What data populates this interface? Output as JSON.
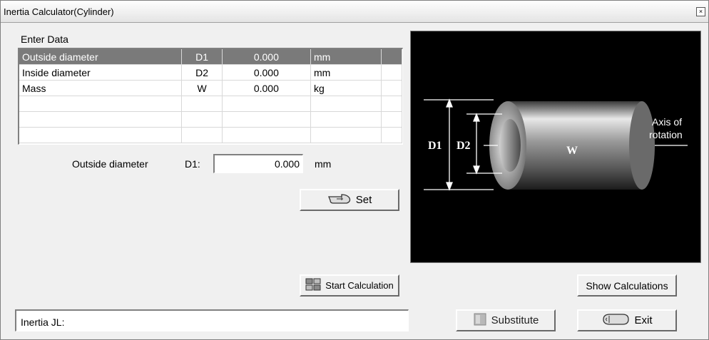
{
  "window": {
    "title": "Inertia Calculator(Cylinder)",
    "close_glyph": "×"
  },
  "enter_data_label": "Enter Data",
  "table": {
    "rows": [
      {
        "name": "Outside diameter",
        "symbol": "D1",
        "value": "0.000",
        "unit": "mm"
      },
      {
        "name": "Inside diameter",
        "symbol": "D2",
        "value": "0.000",
        "unit": "mm"
      },
      {
        "name": "Mass",
        "symbol": "W",
        "value": "0.000",
        "unit": "kg"
      }
    ]
  },
  "editor": {
    "field_label": "Outside diameter",
    "symbol_label": "D1:",
    "value": "0.000",
    "unit": "mm"
  },
  "buttons": {
    "set": "Set",
    "start_calculation": "Start Calculation",
    "show_calculations": "Show Calculations",
    "substitute": "Substitute",
    "exit": "Exit"
  },
  "result": {
    "label": "Inertia JL:"
  },
  "diagram": {
    "d1": "D1",
    "d2": "D2",
    "w": "W",
    "axis_line1": "Axis of",
    "axis_line2": "rotation"
  },
  "colors": {
    "selected_row": "#7a7a7a",
    "diagram_bg": "#000000"
  },
  "icons": {
    "set": "pointing-hand-icon",
    "start": "grid-icon",
    "substitute": "square-icon",
    "exit": "hand-icon",
    "close": "close-icon"
  }
}
